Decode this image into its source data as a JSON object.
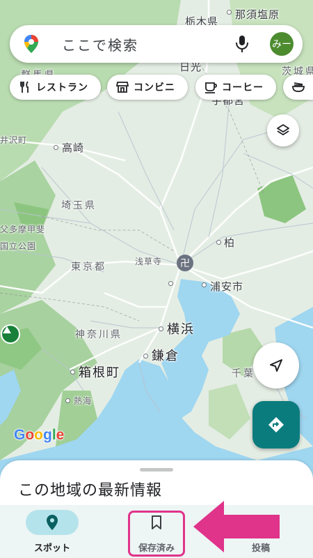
{
  "search": {
    "placeholder": "ここで検索",
    "avatar_text": "みー"
  },
  "chips": [
    {
      "label": "レストラン",
      "icon": "restaurant-icon"
    },
    {
      "label": "コンビニ",
      "icon": "store-icon"
    },
    {
      "label": "コーヒー",
      "icon": "coffee-icon"
    },
    {
      "label": "",
      "icon": "ramen-icon"
    }
  ],
  "map": {
    "labels": {
      "tochigi": "栃木県",
      "nasushiobara": "那須塩原",
      "gunma": "群馬県",
      "ibaraki": "茨城県",
      "nikko": "日光",
      "utsunomiya": "宇都宮",
      "karuizawa": "井沢町",
      "takasaki": "高崎",
      "saitama": "埼玉県",
      "chichibu": "父多摩甲斐",
      "national_park": "国立公園",
      "tokyo": "東京都",
      "asakusa": "浅草寺",
      "kashiwa": "柏",
      "urayasu": "浦安市",
      "kanagawa": "神奈川県",
      "yokohama": "横浜",
      "kamakura": "鎌倉",
      "hakone": "箱根町",
      "atami": "熱海",
      "chiba": "千葉"
    },
    "google_logo": [
      "G",
      "o",
      "o",
      "g",
      "l",
      "e"
    ],
    "google_colors": [
      "#4285F4",
      "#EA4335",
      "#FBBC05",
      "#4285F4",
      "#34A853",
      "#EA4335"
    ]
  },
  "sheet": {
    "title": "この地域の最新情報"
  },
  "nav": {
    "items": [
      {
        "label": "スポット",
        "icon": "location-pin-icon",
        "active": true
      },
      {
        "label": "保存済み",
        "icon": "bookmark-icon",
        "active": false
      },
      {
        "label": "投稿",
        "icon": "add-post-icon",
        "active": false
      }
    ]
  },
  "colors": {
    "accent": "#0b7c7e",
    "highlight": "#e0338a",
    "nav_active_pill": "#b5e3ec",
    "water": "#9fd6f0",
    "land": "#e6eee6"
  }
}
